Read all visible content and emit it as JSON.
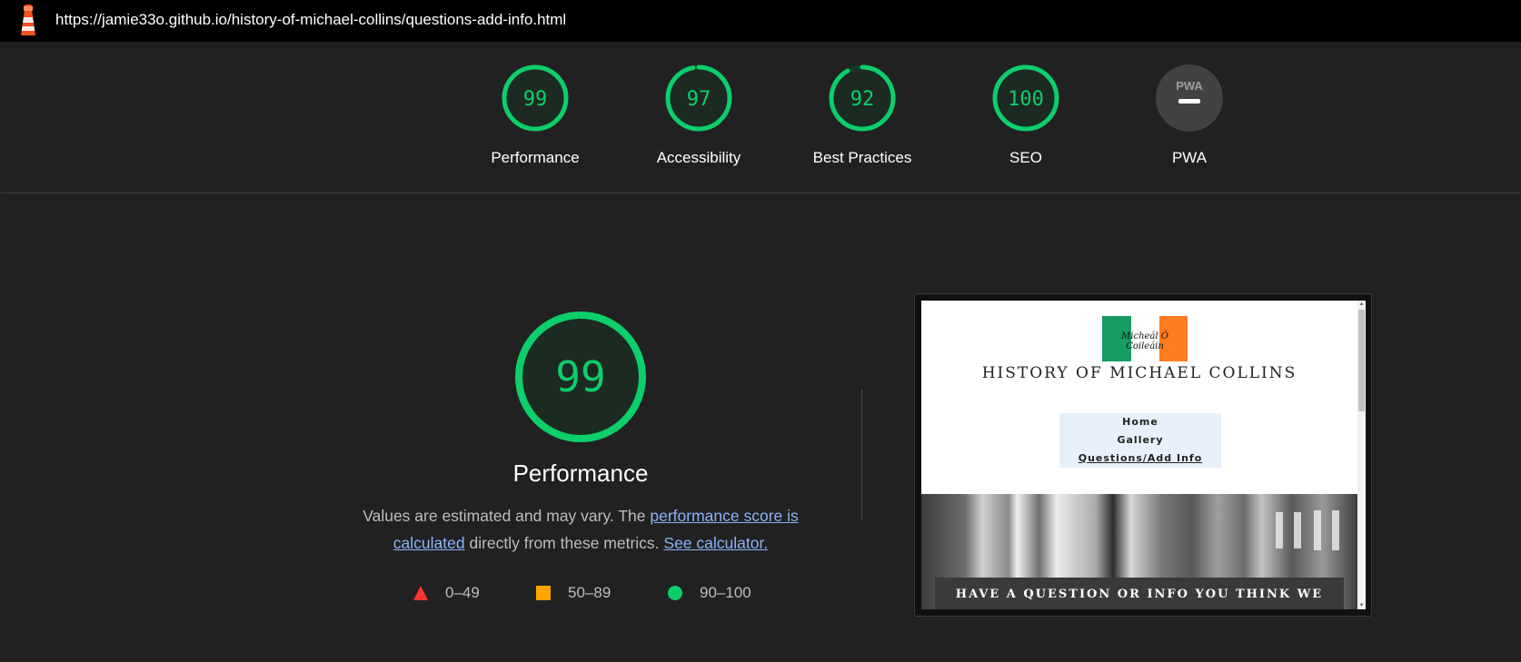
{
  "topbar": {
    "url": "https://jamie33o.github.io/history-of-michael-collins/questions-add-info.html",
    "logo_icon": "lighthouse-icon"
  },
  "gauges": [
    {
      "label": "Performance",
      "score": 99,
      "color": "#0cce6b"
    },
    {
      "label": "Accessibility",
      "score": 97,
      "color": "#0cce6b"
    },
    {
      "label": "Best Practices",
      "score": 92,
      "color": "#0cce6b"
    },
    {
      "label": "SEO",
      "score": 100,
      "color": "#0cce6b"
    },
    {
      "label": "PWA",
      "badge_text": "PWA",
      "color": "#9e9e9e"
    }
  ],
  "performance": {
    "score": 99,
    "title": "Performance",
    "desc_prefix": "Values are estimated and may vary. The ",
    "link_score": "performance score is calculated",
    "desc_middle": " directly from these metrics. ",
    "link_calc": "See calculator.",
    "legend": [
      {
        "range": "0–49",
        "icon": "triangle-icon",
        "color": "#ff3333"
      },
      {
        "range": "50–89",
        "icon": "square-icon",
        "color": "#ffa400"
      },
      {
        "range": "90–100",
        "icon": "circle-icon",
        "color": "#0cce6b"
      }
    ]
  },
  "screenshot": {
    "flag_text": "Micheál Ó Coileáin",
    "site_title": "HISTORY OF MICHAEL COLLINS",
    "nav": [
      "Home",
      "Gallery",
      "Questions/Add Info"
    ],
    "hero_caption": "HAVE A QUESTION OR INFO YOU THINK WE"
  }
}
